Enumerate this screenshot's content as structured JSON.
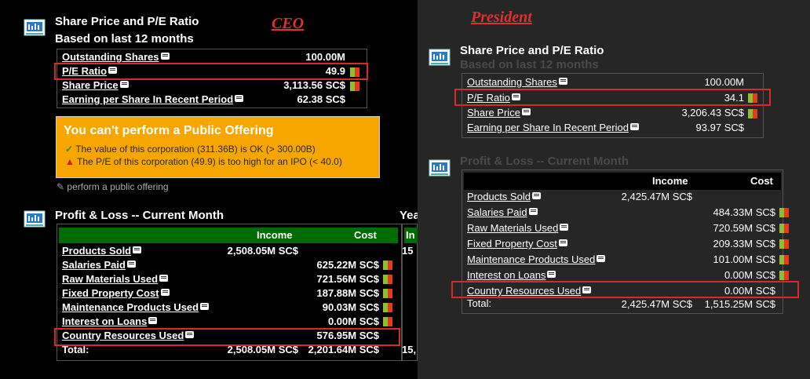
{
  "ceo": {
    "tag": "CEO",
    "share_section": {
      "title": "Share Price and P/E Ratio",
      "subtitle": "Based on last 12 months",
      "rows": [
        {
          "label": "Outstanding Shares",
          "value": "100.00M",
          "unit": ""
        },
        {
          "label": "P/E Ratio",
          "value": "49.9",
          "unit": ""
        },
        {
          "label": "Share Price",
          "value": "3,113.56",
          "unit": "SC$"
        },
        {
          "label": "Earning per Share In Recent Period",
          "value": "62.38",
          "unit": "SC$"
        }
      ]
    },
    "warning": {
      "title": "You can't perform a Public Offering",
      "ok_line": "The value of this corporation (311.36B) is OK (> 300.00B)",
      "error_line": "The P/E of this corporation (49.9) is too high for an IPO (< 40.0)"
    },
    "public_offering_link": "perform a public offering",
    "pl_section": {
      "title": "Profit & Loss -- Current Month",
      "col_income": "Income",
      "col_cost": "Cost",
      "rows": [
        {
          "label": "Products Sold",
          "income": "2,508.05M SC$",
          "cost": ""
        },
        {
          "label": "Salaries Paid",
          "income": "",
          "cost": "625.22M SC$"
        },
        {
          "label": "Raw Materials Used",
          "income": "",
          "cost": "721.56M SC$"
        },
        {
          "label": "Fixed Property Cost",
          "income": "",
          "cost": "187.88M SC$"
        },
        {
          "label": "Maintenance Products Used",
          "income": "",
          "cost": "90.03M SC$"
        },
        {
          "label": "Interest on Loans",
          "income": "",
          "cost": "0.00M SC$"
        },
        {
          "label": "Country Resources Used",
          "income": "",
          "cost": "576.95M SC$"
        }
      ],
      "total_label": "Total:",
      "total_income": "2,508.05M SC$",
      "total_cost": "2,201.64M SC$"
    },
    "ye_section": {
      "title_partial": "Yea",
      "hdr_partial": "In",
      "row_partial": "15",
      "total_partial": "15,"
    }
  },
  "president": {
    "tag": "President",
    "share_section": {
      "title": "Share Price and P/E Ratio",
      "subtitle": "Based on last 12 months",
      "rows": [
        {
          "label": "Outstanding Shares",
          "value": "100.00M",
          "unit": ""
        },
        {
          "label": "P/E Ratio",
          "value": "34.1",
          "unit": ""
        },
        {
          "label": "Share Price",
          "value": "3,206.43",
          "unit": "SC$"
        },
        {
          "label": "Earning per Share In Recent Period",
          "value": "93.97",
          "unit": "SC$"
        }
      ]
    },
    "pl_section": {
      "title": "Profit & Loss -- Current Month",
      "col_income": "Income",
      "col_cost": "Cost",
      "rows": [
        {
          "label": "Products Sold",
          "income": "2,425.47M SC$",
          "cost": ""
        },
        {
          "label": "Salaries Paid",
          "income": "",
          "cost": "484.33M SC$"
        },
        {
          "label": "Raw Materials Used",
          "income": "",
          "cost": "720.59M SC$"
        },
        {
          "label": "Fixed Property Cost",
          "income": "",
          "cost": "209.33M SC$"
        },
        {
          "label": "Maintenance Products Used",
          "income": "",
          "cost": "101.00M SC$"
        },
        {
          "label": "Interest on Loans",
          "income": "",
          "cost": "0.00M SC$"
        },
        {
          "label": "Country Resources Used",
          "income": "",
          "cost": "0.00M SC$"
        }
      ],
      "total_label": "Total:",
      "total_income": "2,425.47M SC$",
      "total_cost": "1,515.25M SC$"
    }
  },
  "colors": {
    "highlight_red": "#d42b2b",
    "warning_bg": "#f7a600",
    "header_green": "#006b00",
    "flag_green": "#8fbf2f",
    "flag_red": "#e53b1c"
  }
}
